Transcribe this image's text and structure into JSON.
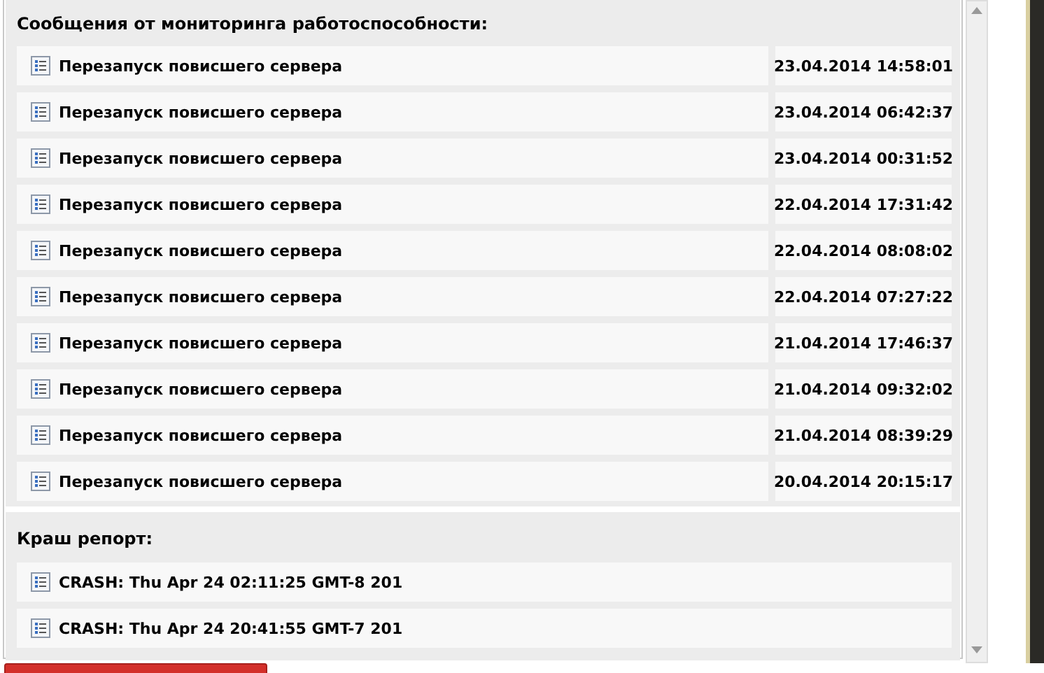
{
  "sections": [
    {
      "title": "Сообщения от мониторинга работоспособности:",
      "kind": "dated",
      "rows": [
        {
          "text": "Перезапуск повисшего сервера",
          "date": "23.04.2014 14:58:01"
        },
        {
          "text": "Перезапуск повисшего сервера",
          "date": "23.04.2014 06:42:37"
        },
        {
          "text": "Перезапуск повисшего сервера",
          "date": "23.04.2014 00:31:52"
        },
        {
          "text": "Перезапуск повисшего сервера",
          "date": "22.04.2014 17:31:42"
        },
        {
          "text": "Перезапуск повисшего сервера",
          "date": "22.04.2014 08:08:02"
        },
        {
          "text": "Перезапуск повисшего сервера",
          "date": "22.04.2014 07:27:22"
        },
        {
          "text": "Перезапуск повисшего сервера",
          "date": "21.04.2014 17:46:37"
        },
        {
          "text": "Перезапуск повисшего сервера",
          "date": "21.04.2014 09:32:02"
        },
        {
          "text": "Перезапуск повисшего сервера",
          "date": "21.04.2014 08:39:29"
        },
        {
          "text": "Перезапуск повисшего сервера",
          "date": "20.04.2014 20:15:17"
        }
      ]
    },
    {
      "title": "Краш репорт:",
      "kind": "plain",
      "rows": [
        {
          "text": "CRASH: Thu Apr 24 02:11:25 GMT-8 201"
        },
        {
          "text": "CRASH: Thu Apr 24 20:41:55 GMT-7 201"
        }
      ]
    }
  ]
}
